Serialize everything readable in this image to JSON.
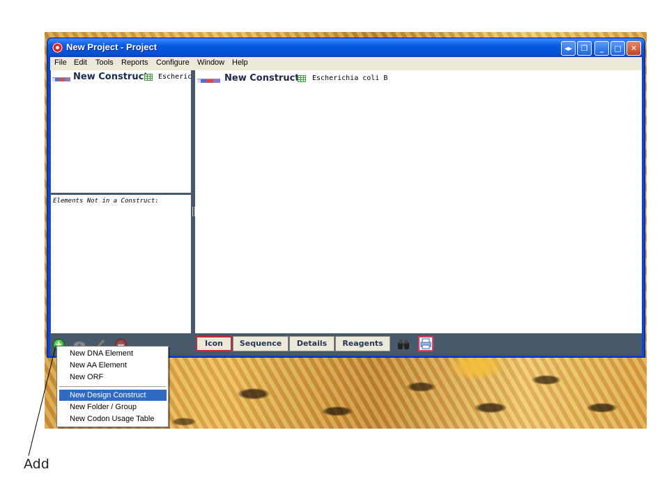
{
  "window": {
    "title": "New Project - Project"
  },
  "menubar": [
    "File",
    "Edit",
    "Tools",
    "Reports",
    "Configure",
    "Window",
    "Help"
  ],
  "left_top": {
    "construct_name": "New Construct",
    "organism": "Escherich"
  },
  "left_bottom": {
    "label": "Elements Not in a Construct:"
  },
  "right_panel": {
    "construct_name": "New Construct",
    "organism": "Escherichia coli B"
  },
  "view_tabs": [
    "Icon",
    "Sequence",
    "Details",
    "Reagents"
  ],
  "active_view": "Icon",
  "popup_menu": {
    "items": [
      "New DNA Element",
      "New AA Element",
      "New ORF",
      "New Design Construct",
      "New Folder / Group",
      "New Codon Usage Table"
    ],
    "selected": "New Design Construct"
  },
  "callout": {
    "label": "Add"
  },
  "colors": {
    "titlebar": "#0859e0",
    "panel_divider": "#47596a",
    "menu_highlight": "#316ac5",
    "active_tab_border": "#c8283a"
  },
  "icons": [
    "app-icon",
    "table-icon",
    "add-icon",
    "view-icon",
    "edit-icon",
    "delete-icon",
    "binoculars-icon",
    "printer-icon"
  ]
}
